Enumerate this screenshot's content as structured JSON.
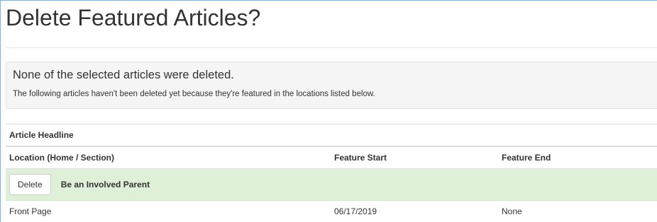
{
  "page": {
    "title": "Delete Featured Articles?"
  },
  "alert": {
    "heading": "None of the selected articles were deleted.",
    "text": "The following articles haven't been deleted yet because they're featured in the locations listed below."
  },
  "table": {
    "article_header": "Article Headline",
    "columns": [
      "Location (Home / Section)",
      "Feature Start",
      "Feature End"
    ],
    "articles": [
      {
        "delete_label": "Delete",
        "headline": "Be an Involved Parent",
        "locations": [
          {
            "location": "Front Page",
            "start": "06/17/2019",
            "end": "None"
          }
        ]
      }
    ]
  },
  "colors": {
    "success_row": "#dff0d8",
    "alert_bg": "#f5f5f5",
    "border": "#dddddd",
    "text": "#333333"
  }
}
